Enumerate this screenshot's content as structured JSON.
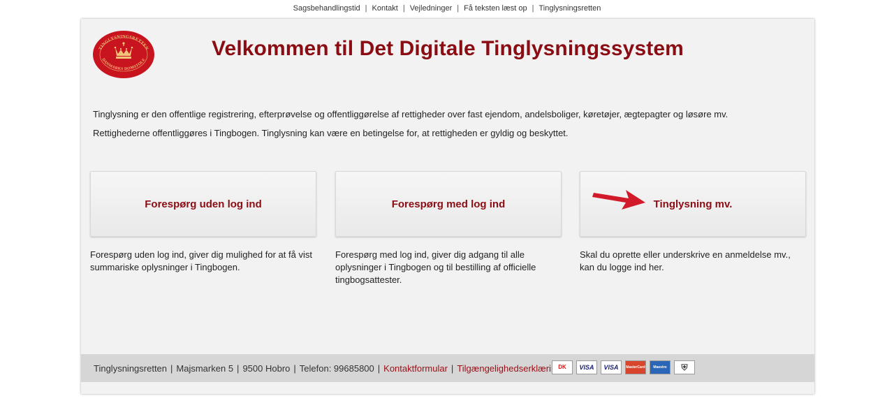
{
  "topnav": {
    "items": [
      "Sagsbehandlingstid",
      "Kontakt",
      "Vejledninger",
      "Få teksten læst op",
      "Tinglysningsretten"
    ]
  },
  "header": {
    "title": "Velkommen til Det Digitale Tinglysningssystem",
    "logo_top_text": "TINGLYSNINGSRETTEN",
    "logo_bottom_text": "DANMARKS DOMSTOLE"
  },
  "intro": {
    "line1": "Tinglysning er den offentlige registrering, efterprøvelse og offentliggørelse af rettigheder over fast ejendom, andelsboliger, køretøjer, ægtepagter og løsøre mv.",
    "line2": "Rettighederne offentliggøres i Tingbogen. Tinglysning kan være en betingelse for, at rettigheden er gyldig og beskyttet."
  },
  "options": [
    {
      "label": "Forespørg uden log ind",
      "description": "Forespørg uden log ind, giver dig mulighed for at få vist summariske oplysninger i Tingbogen."
    },
    {
      "label": "Forespørg med log ind",
      "description": "Forespørg med log ind, giver dig adgang til alle oplysninger i Tingbogen og til bestilling af officielle tingbogsattester."
    },
    {
      "label": "Tinglysning mv.",
      "description": "Skal du oprette eller underskrive en anmeldelse mv., kan du logge ind her."
    }
  ],
  "footer": {
    "name": "Tinglysningsretten",
    "address": "Majsmarken 5",
    "city": "9500 Hobro",
    "phone": "Telefon: 99685800",
    "contact_link": "Kontaktformular",
    "accessibility_link": "Tilgængelighedserklæring",
    "payment_cards": [
      "DK",
      "VISA",
      "VISA",
      "MasterCard",
      "Maestro"
    ]
  },
  "colors": {
    "brand_red": "#8b0d14",
    "arrow_red": "#d11a2a"
  }
}
